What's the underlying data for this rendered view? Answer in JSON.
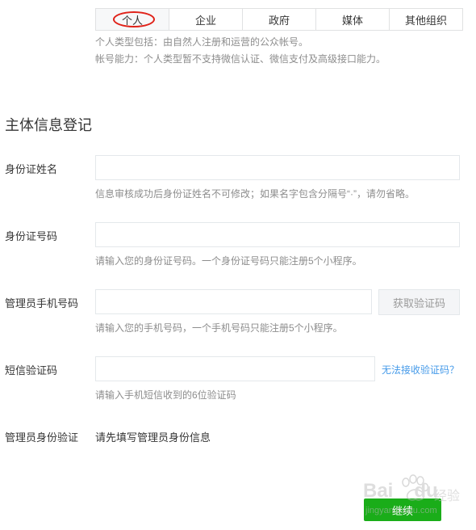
{
  "tabs": [
    {
      "label": "个人",
      "active": true
    },
    {
      "label": "企业",
      "active": false
    },
    {
      "label": "政府",
      "active": false
    },
    {
      "label": "媒体",
      "active": false
    },
    {
      "label": "其他组织",
      "active": false
    }
  ],
  "type_desc": {
    "line1": "个人类型包括：由自然人注册和运营的公众帐号。",
    "line2": "帐号能力：个人类型暂不支持微信认证、微信支付及高级接口能力。"
  },
  "section_title": "主体信息登记",
  "fields": {
    "id_name": {
      "label": "身份证姓名",
      "value": "",
      "tip": "信息审核成功后身份证姓名不可修改；如果名字包含分隔号“·”，请勿省略。"
    },
    "id_number": {
      "label": "身份证号码",
      "value": "",
      "tip": "请输入您的身份证号码。一个身份证号码只能注册5个小程序。"
    },
    "phone": {
      "label": "管理员手机号码",
      "value": "",
      "button": "获取验证码",
      "tip": "请输入您的手机号码，一个手机号码只能注册5个小程序。"
    },
    "sms_code": {
      "label": "短信验证码",
      "value": "",
      "link": "无法接收验证码？",
      "tip": "请输入手机短信收到的6位验证码"
    },
    "admin_verify": {
      "label": "管理员身份验证",
      "value": "请先填写管理员身份信息"
    }
  },
  "next_button": "继续",
  "watermark": {
    "brand": "Bai",
    "brand2": "du",
    "cn": "经验",
    "url": "jingyan.baidu.com"
  },
  "colors": {
    "primary_green": "#1aad19",
    "link_blue": "#459ae9",
    "annotation_red": "#e0231a"
  }
}
